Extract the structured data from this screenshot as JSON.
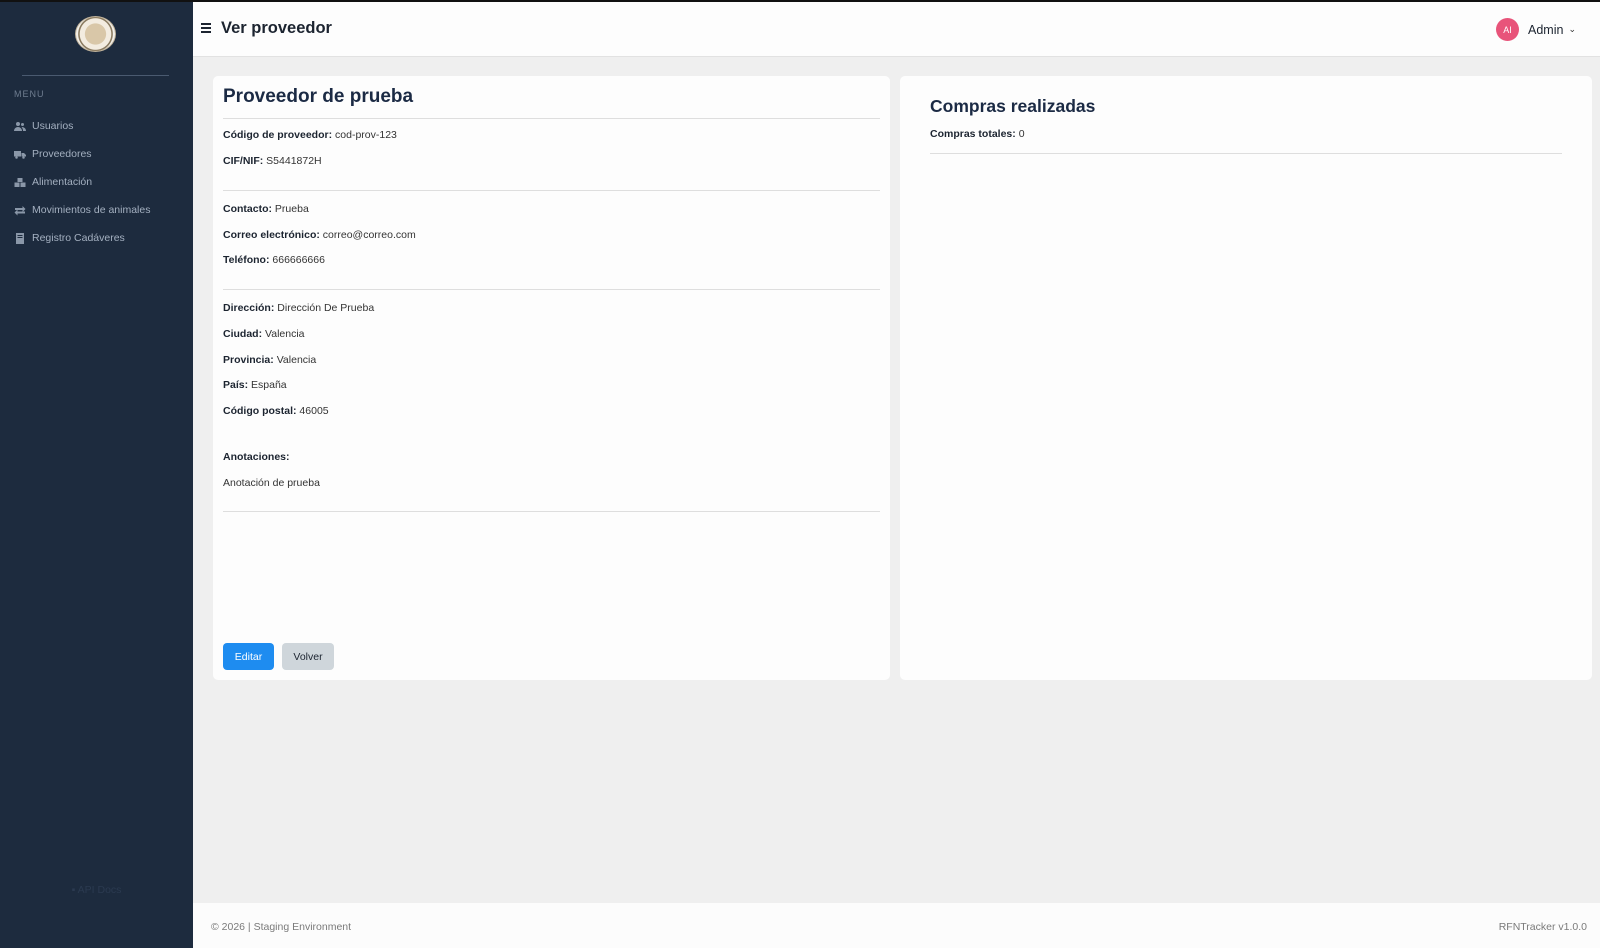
{
  "sidebar": {
    "menu_title": "MENU",
    "items": [
      {
        "label": "Usuarios",
        "icon": "users-icon"
      },
      {
        "label": "Proveedores",
        "icon": "truck-icon"
      },
      {
        "label": "Alimentación",
        "icon": "boxes-icon"
      },
      {
        "label": "Movimientos de animales",
        "icon": "exchange-icon"
      },
      {
        "label": "Registro Cadáveres",
        "icon": "book-icon"
      }
    ],
    "api_docs": "API Docs"
  },
  "header": {
    "title": "Ver proveedor",
    "user": {
      "initials": "AI",
      "name": "Admin"
    }
  },
  "provider": {
    "name": "Proveedor de prueba",
    "fields": [
      {
        "label": "Código de proveedor:",
        "value": "cod-prov-123"
      },
      {
        "label": "CIF/NIF:",
        "value": "S5441872H"
      },
      {
        "label": "Contacto:",
        "value": "Prueba"
      },
      {
        "label": "Correo electrónico:",
        "value": "correo@correo.com"
      },
      {
        "label": "Teléfono:",
        "value": "666666666"
      },
      {
        "label": "Dirección:",
        "value": "Dirección De Prueba"
      },
      {
        "label": "Ciudad:",
        "value": "Valencia"
      },
      {
        "label": "Provincia:",
        "value": "Valencia"
      },
      {
        "label": "País:",
        "value": "España"
      },
      {
        "label": "Código postal:",
        "value": "46005"
      }
    ],
    "notes_label": "Anotaciones:",
    "notes_value": "Anotación de prueba",
    "edit_label": "Editar",
    "back_label": "Volver"
  },
  "purchases": {
    "title": "Compras realizadas",
    "total_label": "Compras totales:",
    "total_value": "0"
  },
  "footer": {
    "left": "© 2026 | Staging Environment",
    "right": "RFNTracker v1.0.0"
  },
  "colors": {
    "sidebar_bg": "#1d2b3e",
    "primary": "#1e8cf0",
    "secondary": "#cfd6db",
    "avatar": "#e8547a"
  }
}
